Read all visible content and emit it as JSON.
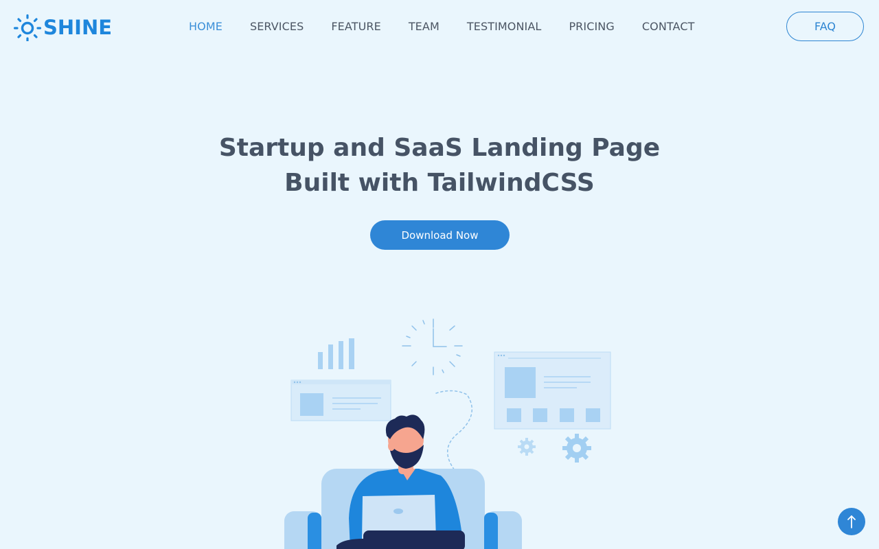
{
  "brand": {
    "name": "SHINE",
    "icon": "sun-icon",
    "color": "#1e86dc"
  },
  "nav": {
    "items": [
      {
        "label": "HOME",
        "active": true
      },
      {
        "label": "SERVICES",
        "active": false
      },
      {
        "label": "FEATURE",
        "active": false
      },
      {
        "label": "TEAM",
        "active": false
      },
      {
        "label": "TESTIMONIAL",
        "active": false
      },
      {
        "label": "PRICING",
        "active": false
      },
      {
        "label": "CONTACT",
        "active": false
      }
    ],
    "faq_label": "FAQ"
  },
  "hero": {
    "title_line1": "Startup and SaaS Landing Page",
    "title_line2": "Built with TailwindCSS",
    "cta_label": "Download Now"
  },
  "scroll_top": {
    "icon": "arrow-up-icon"
  },
  "colors": {
    "background": "#eaf6fd",
    "accent": "#2f86d6",
    "heading": "#465365",
    "nav_text": "#4b5563"
  }
}
